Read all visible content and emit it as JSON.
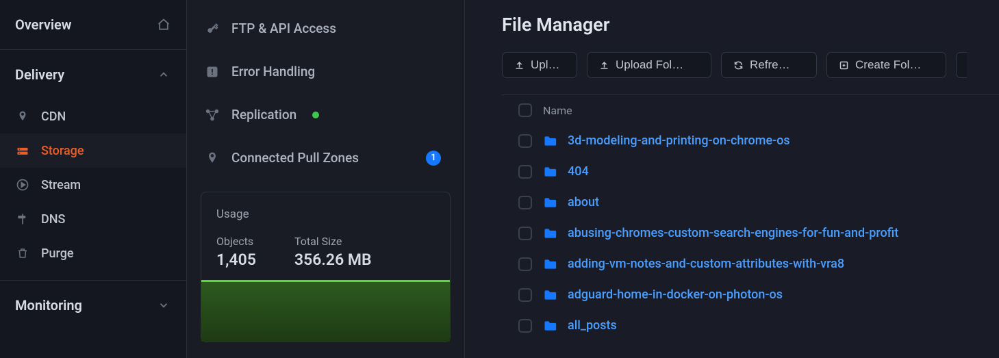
{
  "nav": {
    "overview": "Overview",
    "delivery": "Delivery",
    "monitoring": "Monitoring",
    "items": [
      {
        "label": "CDN"
      },
      {
        "label": "Storage"
      },
      {
        "label": "Stream"
      },
      {
        "label": "DNS"
      },
      {
        "label": "Purge"
      }
    ]
  },
  "sec": {
    "items": [
      {
        "label": "FTP & API Access"
      },
      {
        "label": "Error Handling"
      },
      {
        "label": "Replication"
      },
      {
        "label": "Connected Pull Zones",
        "badge": "1"
      }
    ],
    "usage": {
      "title": "Usage",
      "objects_label": "Objects",
      "objects_value": "1,405",
      "size_label": "Total Size",
      "size_value": "356.26 MB"
    }
  },
  "main": {
    "title": "File Manager",
    "toolbar": {
      "upload": "Uplo…",
      "upload_folder": "Upload Fol…",
      "refresh": "Refre…",
      "create_folder": "Create Fol…"
    },
    "table": {
      "header_name": "Name",
      "rows": [
        {
          "name": "3d-modeling-and-printing-on-chrome-os"
        },
        {
          "name": "404"
        },
        {
          "name": "about"
        },
        {
          "name": "abusing-chromes-custom-search-engines-for-fun-and-profit"
        },
        {
          "name": "adding-vm-notes-and-custom-attributes-with-vra8"
        },
        {
          "name": "adguard-home-in-docker-on-photon-os"
        },
        {
          "name": "all_posts"
        }
      ]
    }
  }
}
